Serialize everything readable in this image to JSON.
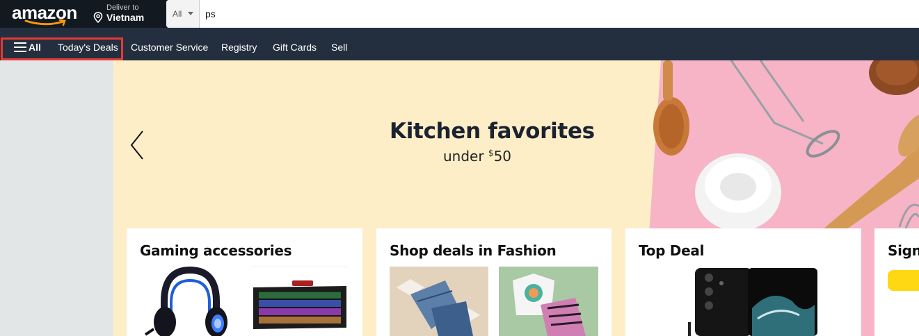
{
  "header": {
    "logo_text": "amazon",
    "deliver_label": "Deliver to",
    "deliver_location": "Vietnam",
    "search": {
      "category": "All",
      "query": "ps"
    }
  },
  "nav": {
    "all_label": "All",
    "items": [
      "Today's Deals",
      "Customer Service",
      "Registry",
      "Gift Cards",
      "Sell"
    ]
  },
  "hero": {
    "title": "Kitchen favorites",
    "subtitle_prefix": "under ",
    "price_symbol": "$",
    "price": "50"
  },
  "cards": [
    {
      "title": "Gaming accessories",
      "tiles": [
        "headset-image",
        "keyboard-image"
      ]
    },
    {
      "title": "Shop deals in Fashion",
      "tiles": [
        "jeans-image",
        "tops-image"
      ]
    },
    {
      "title": "Top Deal",
      "tiles": [
        "phone-image"
      ]
    },
    {
      "title": "Sign"
    }
  ],
  "colors": {
    "header_bg": "#131921",
    "nav_bg": "#232f3e",
    "accent": "#ff9900",
    "highlight_border": "#e53935",
    "hero_bg": "#fdeec8",
    "hero_pink": "#f6b4c6",
    "sign_button": "#ffd814"
  }
}
